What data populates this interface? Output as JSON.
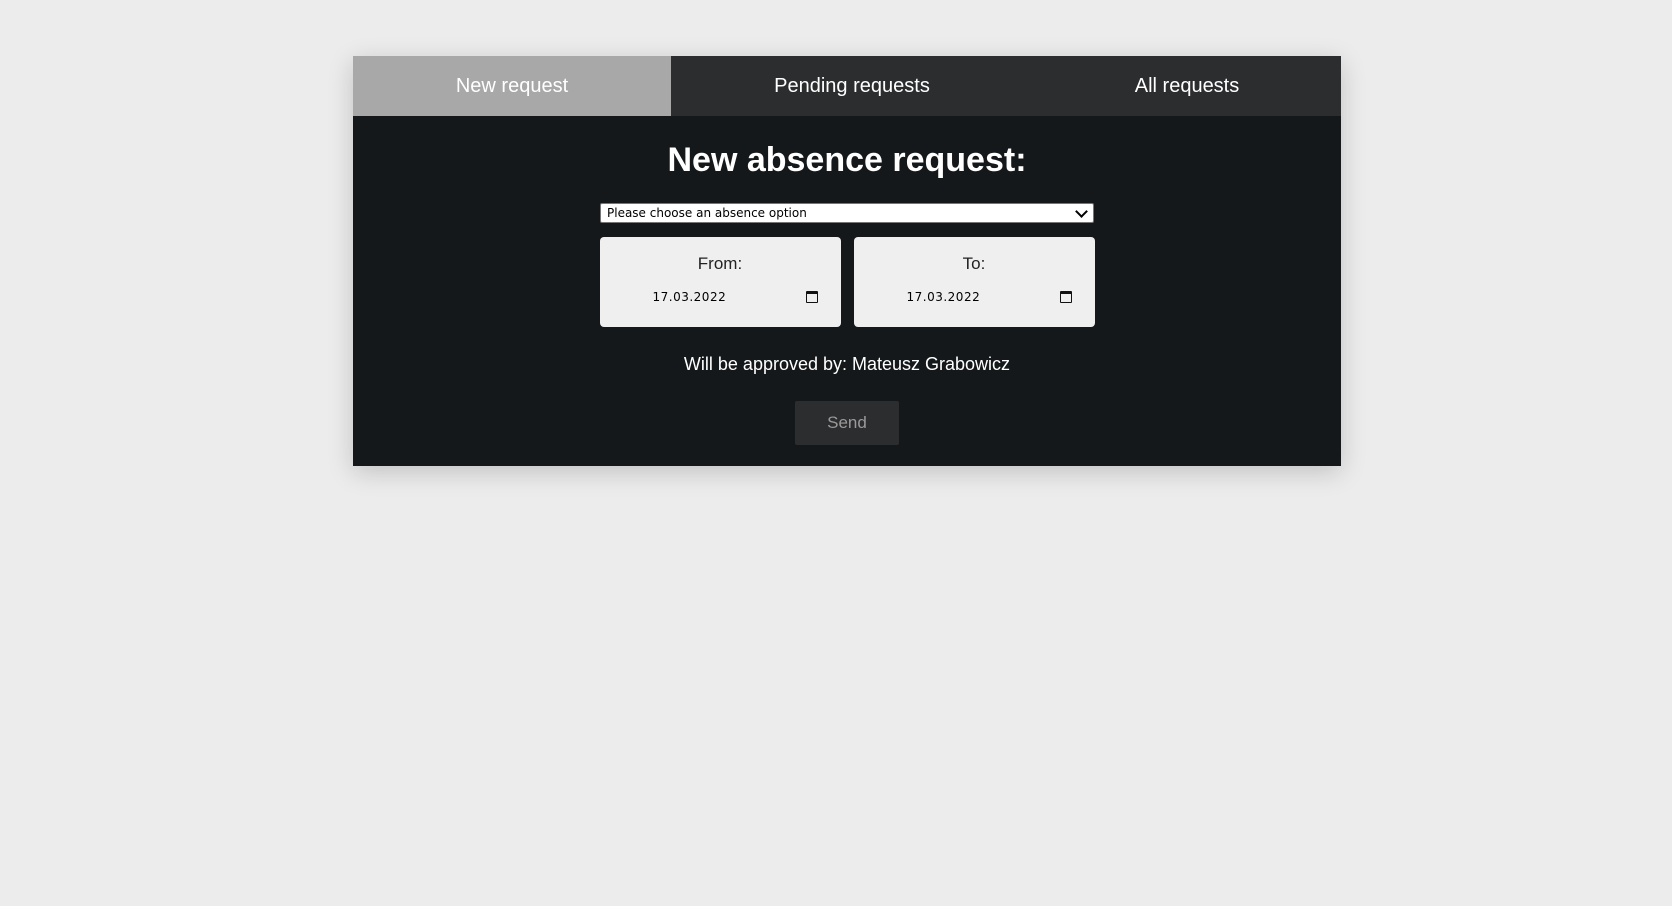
{
  "tabs": {
    "new_request": "New request",
    "pending_requests": "Pending requests",
    "all_requests": "All requests"
  },
  "form": {
    "title": "New absence request:",
    "absence_select": "Please choose an absence option",
    "from_label": "From:",
    "from_value": "17.03.2022",
    "to_label": "To:",
    "to_value": "17.03.2022",
    "approver_text": "Will be approved by: Mateusz Grabowicz",
    "send_label": "Send"
  },
  "icons": {
    "select_chevron": "chevron-down-icon",
    "calendar": "calendar-icon"
  },
  "colors": {
    "page_background": "#ececec",
    "panel_background": "#15181b",
    "tab_bar": "#2c2d2f",
    "active_tab": "#a8a8a8"
  }
}
